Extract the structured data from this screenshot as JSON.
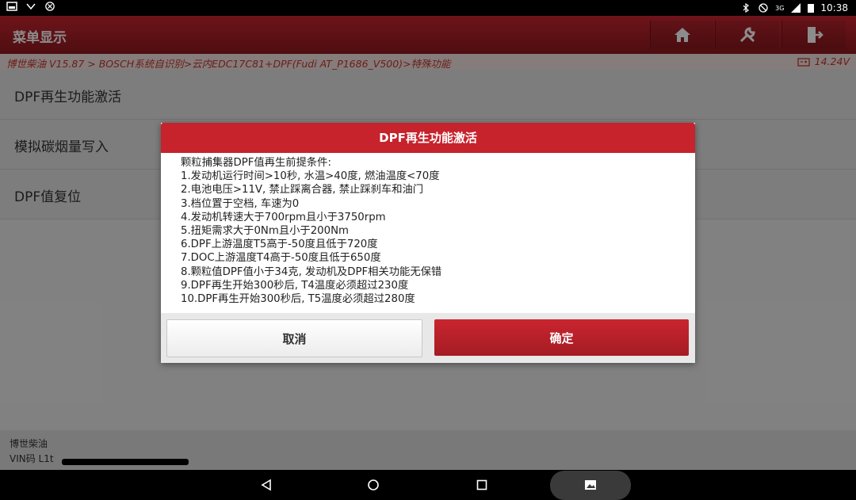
{
  "status_bar": {
    "signal": "3G",
    "time": "10:38"
  },
  "header": {
    "title": "菜单显示",
    "buttons": [
      {
        "name": "home",
        "icon": "home-icon"
      },
      {
        "name": "tools",
        "icon": "wrench-icon"
      },
      {
        "name": "exit",
        "icon": "exit-icon"
      }
    ]
  },
  "breadcrumb": {
    "path": "博世柴油 V15.87 > BOSCH系统自识别>云内EDC17C81+DPF(Fudi AT_P1686_V500)>特殊功能",
    "voltage": "14.24V"
  },
  "menu": {
    "items": [
      {
        "label": "DPF再生功能激活"
      },
      {
        "label": "模拟碳烟量写入"
      },
      {
        "label": "DPF值复位"
      }
    ]
  },
  "dialog": {
    "title": "DPF再生功能激活",
    "lines": [
      "颗粒捕集器DPF值再生前提条件:",
      "1.发动机运行时间>10秒, 水温>40度, 燃油温度<70度",
      "2.电池电压>11V, 禁止踩离合器, 禁止踩刹车和油门",
      "3.档位置于空档, 车速为0",
      "4.发动机转速大于700rpm且小于3750rpm",
      "5.扭矩需求大于0Nm且小于200Nm",
      "6.DPF上游温度T5高于-50度且低于720度",
      "7.DOC上游温度T4高于-50度且低于650度",
      "8.颗粒值DPF值小于34克, 发动机及DPF相关功能无保错",
      "9.DPF再生开始300秒后, T4温度必须超过230度",
      "10.DPF再生开始300秒后, T5温度必须超过280度"
    ],
    "cancel_label": "取消",
    "ok_label": "确定"
  },
  "footer": {
    "line1": "博世柴油",
    "line2": "VIN码 L1t"
  },
  "colors": {
    "accent": "#c6232c",
    "header_dark": "#8f1a1f"
  }
}
